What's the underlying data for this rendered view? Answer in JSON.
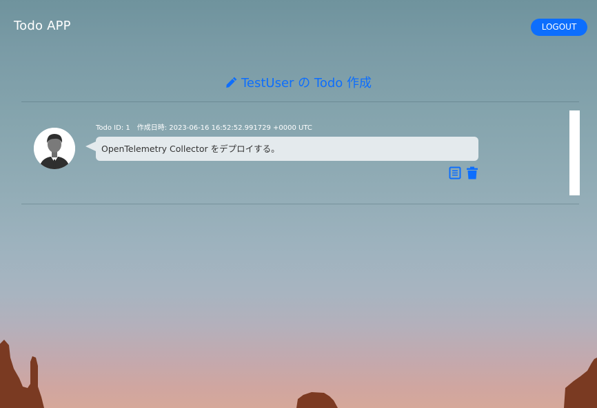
{
  "navbar": {
    "brand": "Todo APP",
    "logout_label": "LOGOUT"
  },
  "page": {
    "title": "TestUser の Todo 作成",
    "title_icon": "pencil-icon"
  },
  "todos": [
    {
      "id_label": "Todo ID: 1",
      "created_label": "作成日時: 2023-06-16 16:52:52.991729 +0000 UTC",
      "content": "OpenTelemetry Collector をデプロイする。",
      "avatar": "user-avatar-icon",
      "actions": [
        "document-icon",
        "trash-icon"
      ]
    }
  ],
  "colors": {
    "accent": "#0d6efd",
    "bubble": "#e4eaed",
    "text_light": "#ffffff",
    "text_dark": "#333333"
  }
}
